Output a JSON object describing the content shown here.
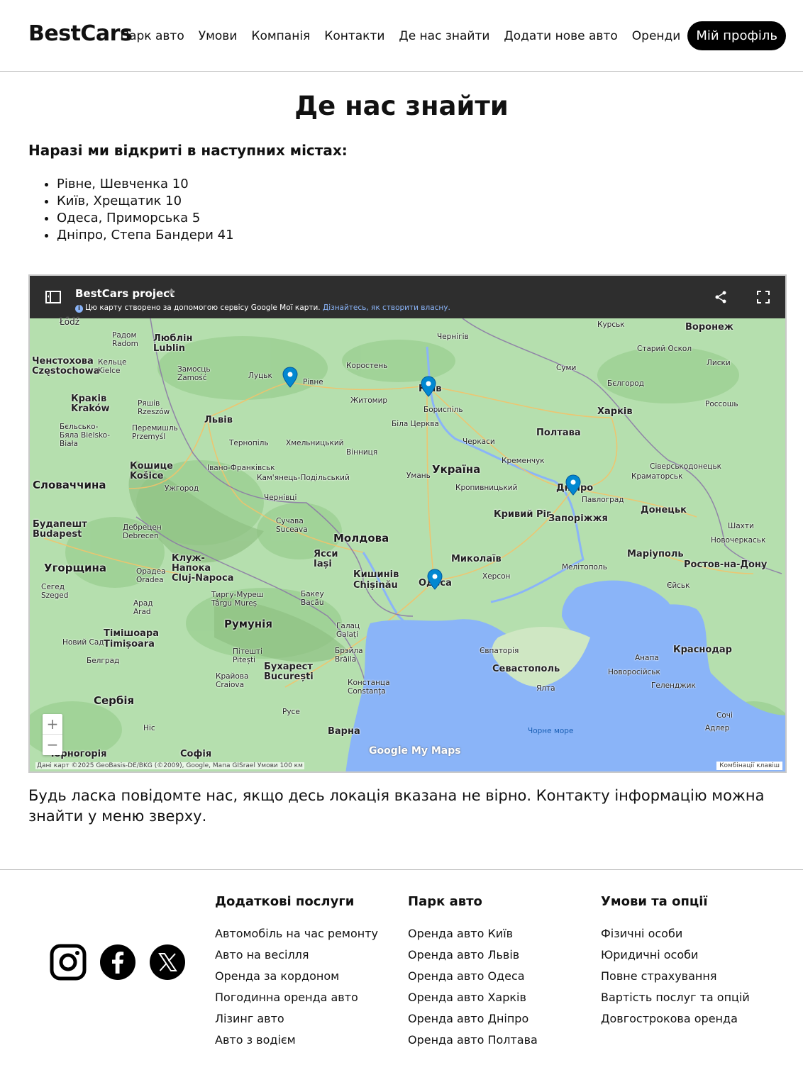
{
  "header": {
    "logo": "BestCars",
    "nav": [
      "Парк авто",
      "Умови",
      "Компанія",
      "Контакти",
      "Де нас знайти",
      "Додати нове авто",
      "Оренди"
    ],
    "profile_button": "Мій профіль"
  },
  "main": {
    "title": "Де нас знайти",
    "cities_heading": "Наразі ми відкриті в наступних містах:",
    "cities": [
      "Рівне, Шевченка 10",
      "Київ, Хрещатик 10",
      "Одеса, Приморська 5",
      "Дніпро, Степа Бандери 41"
    ],
    "note": "Будь ласка повідомте нас, якщо десь локація вказана не вірно. Контакту інформацію можна знайти у меню зверху."
  },
  "map": {
    "title": "BestCars project",
    "subtitle": "Цю карту створено за допомогою сервісу Google Мої карти.",
    "subtitle_link": "Дізнайтесь, як створити власну.",
    "zoom_in": "+",
    "zoom_out": "−",
    "logo": "Google My Maps",
    "attribution": "Дані карт ©2025 GeoBasis-DE/BKG (©2009), Google, Мапа GISrael   Умови   100 км",
    "keyboard": "Комбінації клавіш",
    "pin_color": "#0288d1",
    "labels": {
      "lodz": "Łódź",
      "radom": "Радом Radom",
      "lublin": "Люблін Lublin",
      "czestochowa": "Ченстохова Częstochowa",
      "kielce": "Кельце Kielce",
      "zamosc": "Замосць Zamość",
      "lutsk": "Луцьк",
      "rivne": "Рівне",
      "korosten": "Коростень",
      "chernihiv": "Чернігів",
      "kursk": "Курськ",
      "voronezh": "Воронеж",
      "stary_oskol": "Старий Оскол",
      "sumy": "Суми",
      "liski": "Лиски",
      "krakow": "Краків Kraków",
      "rzeszow": "Ряшів Rzeszów",
      "bielsko": "Бєльсько-Бяла Bielsko-Biała",
      "przemysl": "Перемишль Przemyśl",
      "lviv": "Львів",
      "zhytomyr": "Житомир",
      "kyiv": "Київ",
      "boryspil": "Бориспіль",
      "bilhorod": "Бєлгород",
      "kharkiv": "Харків",
      "rossosh": "Россошь",
      "bila_tserkva": "Біла Церква",
      "ternopil": "Тернопіль",
      "khmelnytskyi": "Хмельницький",
      "vinnytsia": "Вінниця",
      "cherkasy": "Черкаси",
      "poltava": "Полтава",
      "kosice": "Кошице Košice",
      "ivano": "Івано-Франківськ",
      "kremenchuk": "Кременчук",
      "severodonetsk": "Сіверськодонецьк",
      "slovakia": "Словаччина",
      "kamianets": "Кам'янець-Подільський",
      "uman": "Умань",
      "ukraine": "Україна",
      "kramatorsk": "Краматорськ",
      "uzhhorod": "Ужгород",
      "kropyvnytskyi": "Кропивницький",
      "dnipro": "Дніпро",
      "pavlohrad": "Павлоград",
      "chernivtsi": "Чернівці",
      "kryvyi_rih": "Кривий Ріг",
      "donetsk": "Донецьк",
      "budapest": "Будапешт Budapest",
      "debrecen": "Дебрецен Debrecen",
      "suceava": "Сучава Suceava",
      "zaporizhzhia": "Запоріжжя",
      "shakhty": "Шахти",
      "moldova": "Молдова",
      "novocherkassk": "Новочеркаськ",
      "hungary": "Угорщина",
      "cluj": "Клуж-Напока Cluj-Napoca",
      "iasi": "Ясси Iași",
      "mykolaiv": "Миколаїв",
      "mariupol": "Маріуполь",
      "rostov": "Ростов-на-Дону",
      "oradea": "Орадеа Oradea",
      "kishinev": "Кишинів Chișinău",
      "kherson": "Херсон",
      "melitopol": "Мелітополь",
      "szeged": "Сегед Szeged",
      "odesa": "Одеса",
      "yeysk": "Єйськ",
      "arad": "Арад Arad",
      "targu": "Тиргу-Муреш Târgu Mureș",
      "bacau": "Бакеу Bacău",
      "romania": "Румунія",
      "galati": "Галац Galați",
      "timisoara": "Тімішоара Timișoara",
      "novi_sad": "Новий Сад",
      "yevpatoria": "Євпаторія",
      "krasnodar": "Краснодар",
      "pitesti": "Пітешті Pitești",
      "braila": "Брэйла Brăila",
      "belgrade": "Белград",
      "anapa": "Анапа",
      "sevastopol": "Севастополь",
      "novorossiysk": "Новоросійськ",
      "bucharest": "Бухарест București",
      "craiova": "Крайова Craiova",
      "constanta": "Констанца Constanța",
      "yalta": "Ялта",
      "gelendzhik": "Геленджик",
      "serbia": "Сербія",
      "ruse": "Русе",
      "black_sea": "Чорне море",
      "varna": "Варна",
      "sochi": "Сочі",
      "adler": "Адлер",
      "nis": "Ніс",
      "sofia": "Софія",
      "montenegro": "Чорногорія"
    }
  },
  "footer": {
    "columns": [
      {
        "heading": "Додаткові послуги",
        "items": [
          "Автомобіль на час ремонту",
          "Авто на весілля",
          "Оренда за кордоном",
          "Погодинна оренда авто",
          "Лізинг авто",
          "Авто з водієм"
        ]
      },
      {
        "heading": "Парк авто",
        "items": [
          "Оренда авто Київ",
          "Оренда авто Львів",
          "Оренда авто Одеса",
          "Оренда авто Харків",
          "Оренда авто Дніпро",
          "Оренда авто Полтава"
        ]
      },
      {
        "heading": "Умови та опції",
        "items": [
          "Фізичні особи",
          "Юридичні особи",
          "Повне страхування",
          "Вартість послуг та опцій",
          "Довгострокова оренда"
        ]
      }
    ],
    "socials": [
      "instagram-icon",
      "facebook-icon",
      "x-icon"
    ]
  }
}
